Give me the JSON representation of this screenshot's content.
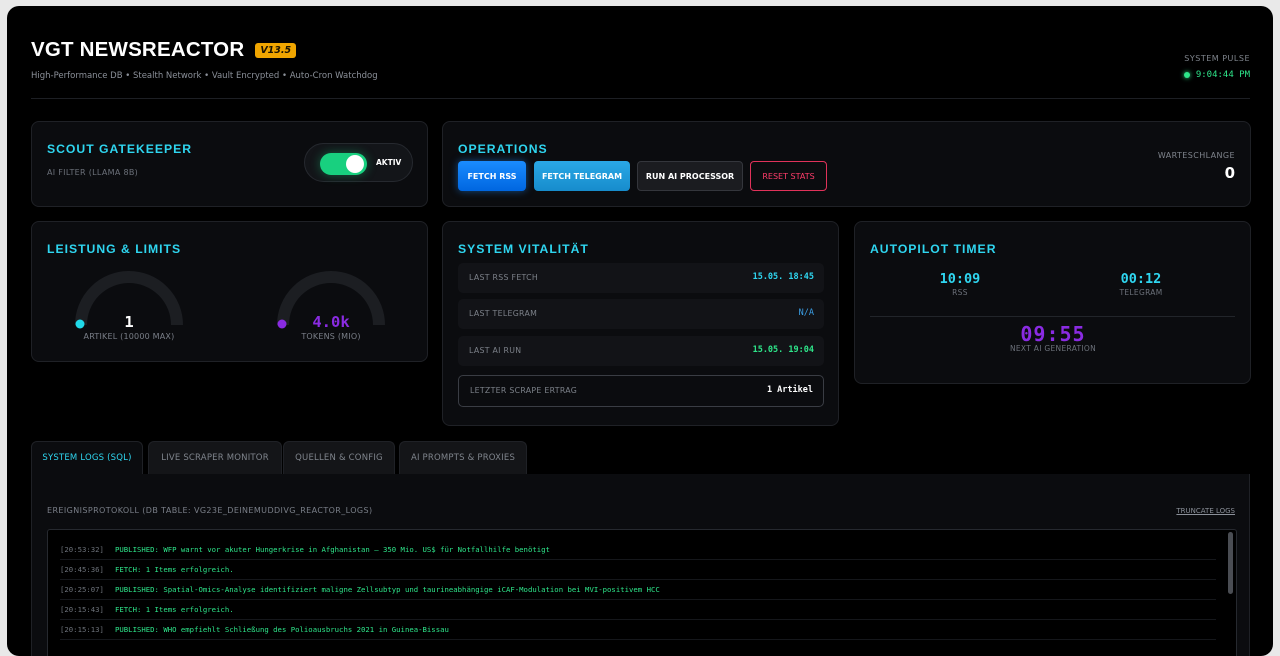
{
  "header": {
    "title": "VGT NEWSREACTOR",
    "version": "V13.5",
    "subtitle": "High-Performance DB • Stealth Network • Vault Encrypted • Auto-Cron Watchdog",
    "pulse_label": "SYSTEM PULSE",
    "pulse_time": "9:04:44 PM",
    "pulse_color": "#2ee58a"
  },
  "scout": {
    "title": "SCOUT GATEKEEPER",
    "subtitle": "AI FILTER (LLAMA 8B)",
    "toggle_label": "AKTIV",
    "toggle_on": true
  },
  "operations": {
    "title": "OPERATIONS",
    "buttons": [
      "FETCH RSS",
      "FETCH TELEGRAM",
      "RUN AI PROCESSOR",
      "RESET STATS"
    ],
    "queue_label": "WARTESCHLANGE",
    "queue_value": "0"
  },
  "limits": {
    "title": "LEISTUNG & LIMITS",
    "gauges": [
      {
        "value": "1",
        "label": "ARTIKEL (10000 MAX)",
        "fraction": 0.0001,
        "color": "#20d9e8"
      },
      {
        "value": "4.0k",
        "label": "TOKENS (MIO)",
        "fraction": 0.0,
        "color": "#8a2be2"
      }
    ]
  },
  "vitality": {
    "title": "SYSTEM VITALITÄT",
    "rows": [
      {
        "label": "LAST RSS FETCH",
        "value": "15.05. 18:45",
        "color": "#2fd6f0"
      },
      {
        "label": "LAST TELEGRAM",
        "value": "N/A",
        "color": "#3ba0e8"
      },
      {
        "label": "LAST AI RUN",
        "value": "15.05. 19:04",
        "color": "#2ee58a"
      },
      {
        "label": "LETZTER SCRAPE ERTRAG",
        "value": "1 Artikel",
        "color": "#ffffff"
      }
    ]
  },
  "autopilot": {
    "title": "AUTOPILOT TIMER",
    "rss_time": "10:09",
    "rss_label": "RSS",
    "telegram_time": "00:12",
    "telegram_label": "TELEGRAM",
    "ai_time": "09:55",
    "ai_label": "NEXT AI GENERATION"
  },
  "tabs": [
    "SYSTEM LOGS (SQL)",
    "LIVE SCRAPER MONITOR",
    "QUELLEN & CONFIG",
    "AI PROMPTS & PROXIES"
  ],
  "logs": {
    "heading": "EREIGNISPROTOKOLL (DB TABLE: VG23E_DEINEMUDDIVG_REACTOR_LOGS)",
    "truncate_label": "TRUNCATE LOGS",
    "entries": [
      {
        "time": "[20:53:32]",
        "message": "PUBLISHED: WFP warnt vor akuter Hungerkrise in Afghanistan – 350 Mio. US$ für Notfallhilfe benötigt"
      },
      {
        "time": "[20:45:36]",
        "message": "FETCH: 1 Items erfolgreich."
      },
      {
        "time": "[20:25:07]",
        "message": "PUBLISHED: Spatial-Omics-Analyse identifiziert maligne Zellsubtyp und taurineabhängige iCAF-Modulation bei MVI-positivem HCC"
      },
      {
        "time": "[20:15:43]",
        "message": "FETCH: 1 Items erfolgreich."
      },
      {
        "time": "[20:15:13]",
        "message": "PUBLISHED: WHO empfiehlt Schließung des Polioausbruchs 2021 in Guinea-Bissau"
      }
    ]
  }
}
